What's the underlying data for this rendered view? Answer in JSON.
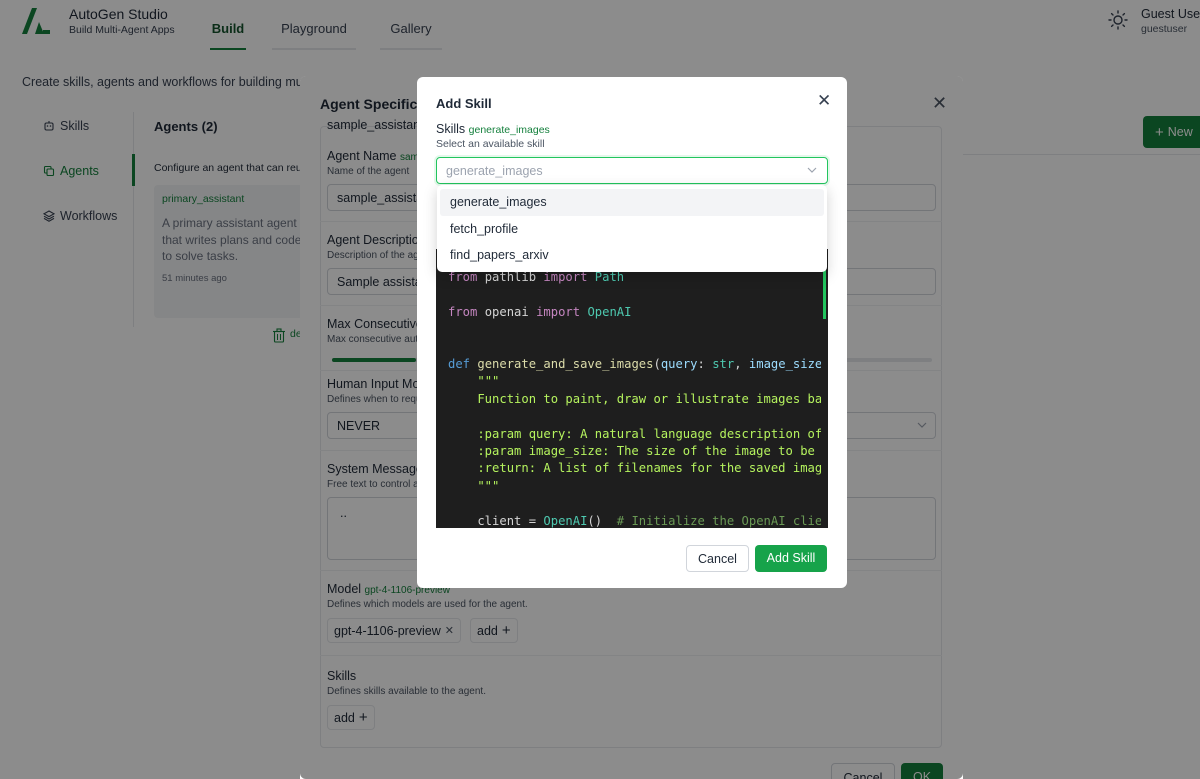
{
  "app": {
    "title": "AutoGen Studio",
    "subtitle": "Build Multi-Agent Apps",
    "tabs": [
      {
        "label": "Build",
        "active": true
      },
      {
        "label": "Playground",
        "active": false
      },
      {
        "label": "Gallery",
        "active": false
      }
    ],
    "user": {
      "name": "Guest User",
      "id": "guestuser"
    },
    "theme_icon": "sun-icon"
  },
  "intro": "Create skills, agents and workflows for building multi-agent capabilities",
  "sidebar": {
    "items": [
      {
        "label": "Skills",
        "icon": "robot-icon",
        "active": false
      },
      {
        "label": "Agents",
        "icon": "copy-icon",
        "active": true
      },
      {
        "label": "Workflows",
        "icon": "layers-icon",
        "active": false
      }
    ]
  },
  "agents_panel": {
    "title": "Agents (2)",
    "description": "Configure an agent that can reuse your skills and accomplish tasks.",
    "card": {
      "name": "primary_assistant",
      "description": "A primary assistant agent that writes plans and code to solve tasks.",
      "time": "51 minutes ago"
    },
    "delete_label": "delete",
    "new_button": "New"
  },
  "agent_modal": {
    "title": "Agent Specification",
    "top_value": "sample_assistant",
    "fields": {
      "name": {
        "label": "Agent Name",
        "tag": "sample_assistant",
        "desc": "Name of the agent",
        "value": "sample_assistant"
      },
      "description": {
        "label": "Agent Description",
        "desc": "Description of the agent",
        "value": "Sample assistant"
      },
      "max_reply": {
        "label": "Max Consecutive Auto Reply",
        "desc": "Max consecutive auto reply messages",
        "fraction": 0.14
      },
      "human_input": {
        "label": "Human Input Mode",
        "desc": "Defines when to request human input",
        "value": "NEVER"
      },
      "system_message": {
        "label": "System Message",
        "desc": "Free text to control agent behavior",
        "value": ".."
      },
      "model": {
        "label": "Model",
        "tag": "gpt-4-1106-preview",
        "desc": "Defines which models are used for the agent.",
        "chip": "gpt-4-1106-preview",
        "add": "add"
      },
      "skills": {
        "label": "Skills",
        "desc": "Defines skills available to the agent.",
        "add": "add"
      }
    },
    "cancel": "Cancel",
    "ok": "OK"
  },
  "skill_modal": {
    "title": "Add Skill",
    "label": "Skills",
    "selected": "generate_images",
    "desc": "Select an available skill",
    "placeholder": "generate_images",
    "options": [
      "generate_images",
      "fetch_profile",
      "find_papers_arxiv"
    ],
    "cancel": "Cancel",
    "add": "Add Skill"
  }
}
